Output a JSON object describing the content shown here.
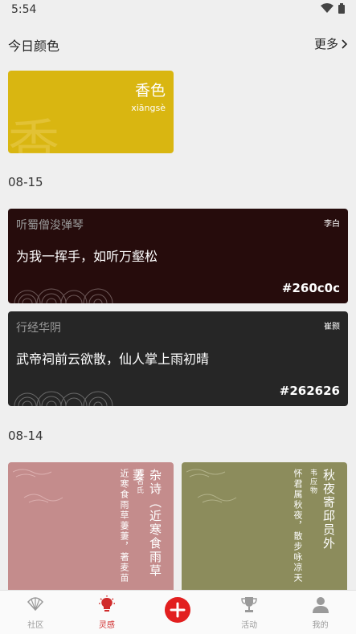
{
  "status": {
    "time": "5:54"
  },
  "today": {
    "section_title": "今日颜色",
    "more_label": "更多",
    "color_name": "香色",
    "pinyin": "xiāngsè",
    "bg_char": "香",
    "color_hex": "#d9b611"
  },
  "groups": [
    {
      "date": "08-15",
      "cards": [
        {
          "title": "听蜀僧浚弹琴",
          "author": "李白",
          "line": "为我一挥手，如听万壑松",
          "hex": "#260c0c"
        },
        {
          "title": "行经华阴",
          "author": "崔颢",
          "line": "武帝祠前云欲散，仙人掌上雨初晴",
          "hex": "#262626"
        }
      ]
    },
    {
      "date": "08-14",
      "tiles": [
        {
          "title": "杂诗（近寒食雨草萋",
          "author": "无名氏",
          "line": "近寒食雨草萋萋，著麦苗",
          "color": "#c48c8c"
        },
        {
          "title": "秋夜寄邱员外",
          "author": "韦应物",
          "line": "怀君属秋夜，散步咏凉天",
          "color": "#8c8c5c"
        }
      ]
    }
  ],
  "nav": {
    "items": [
      {
        "label": "社区",
        "icon": "community-fan-icon"
      },
      {
        "label": "灵感",
        "icon": "inspiration-bulb-icon"
      },
      {
        "label": "",
        "icon": "add-icon"
      },
      {
        "label": "活动",
        "icon": "trophy-icon"
      },
      {
        "label": "我的",
        "icon": "profile-icon"
      }
    ],
    "active_color": "#d02b2b"
  }
}
